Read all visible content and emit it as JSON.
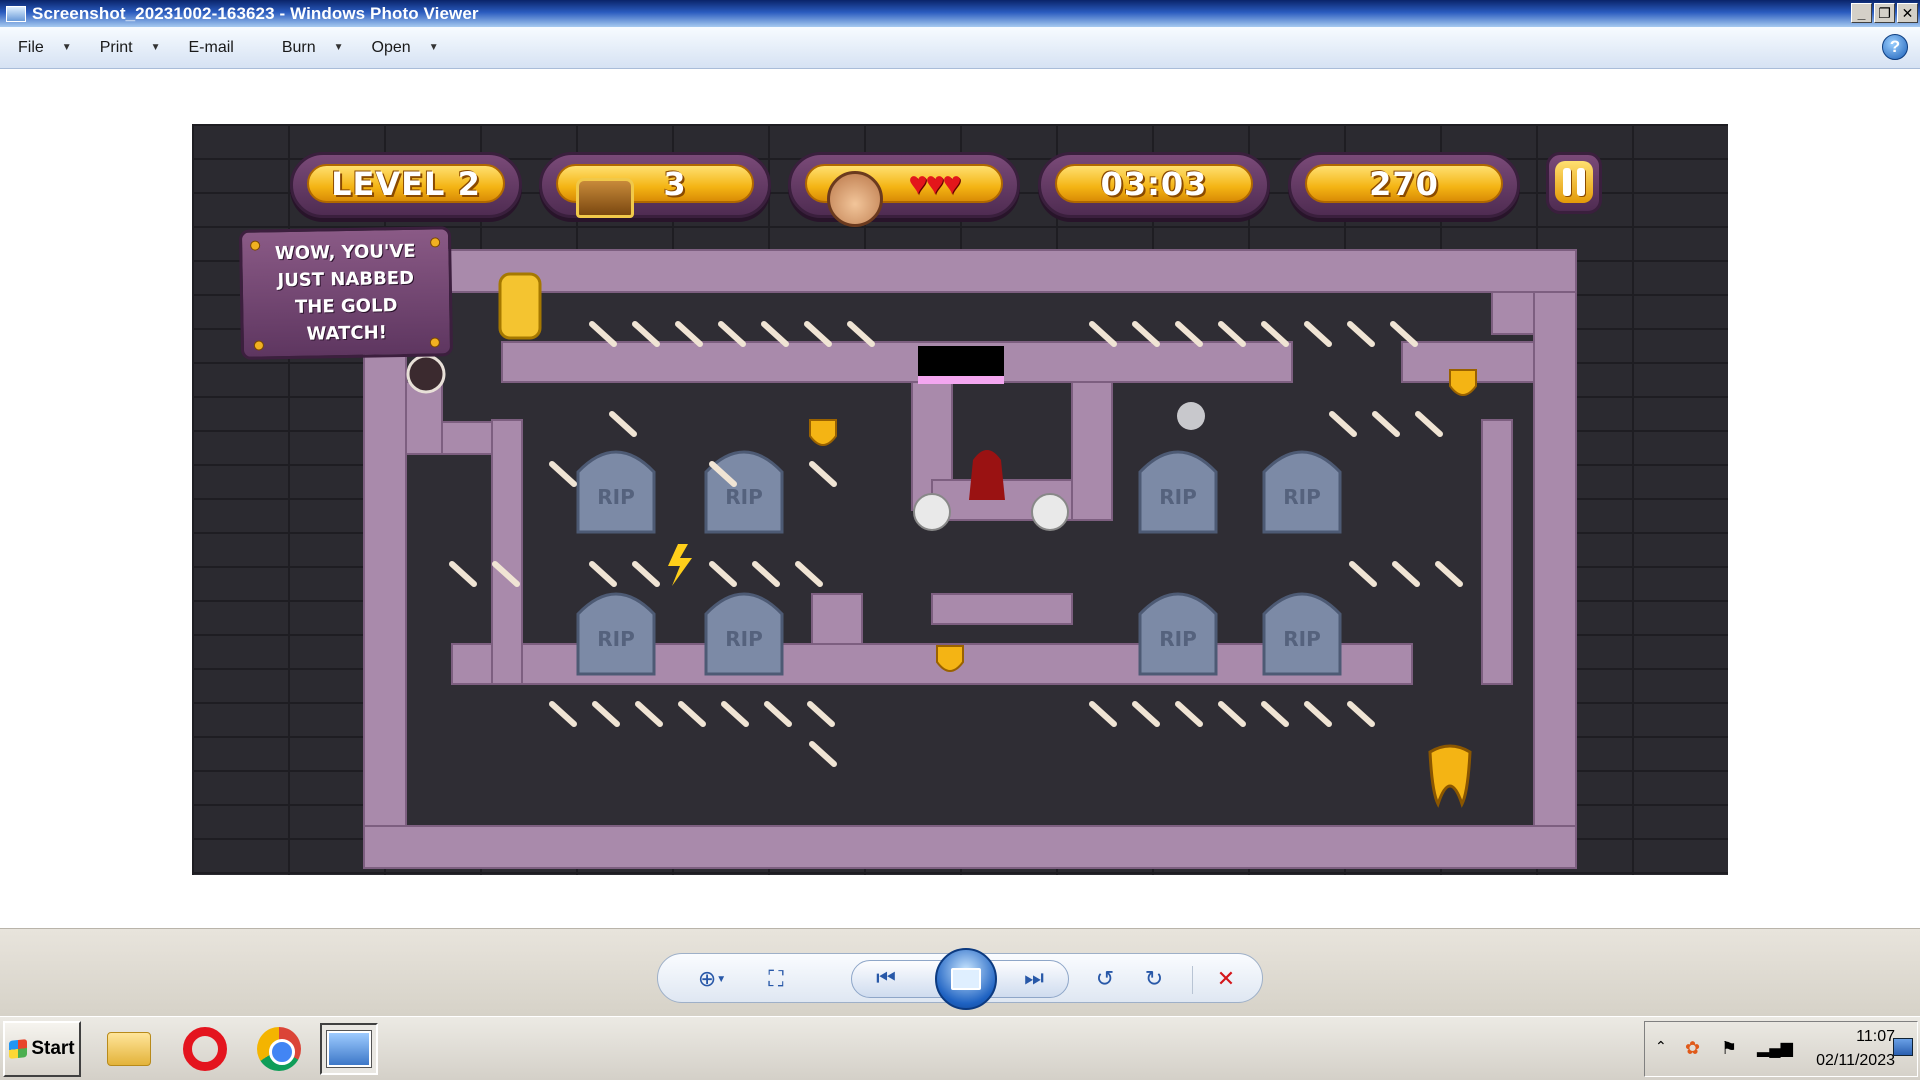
{
  "window": {
    "title": "Screenshot_20231002-163623 - Windows Photo Viewer",
    "controls": {
      "minimize": "_",
      "restore": "❐",
      "close": "✕"
    }
  },
  "menu": {
    "file": "File",
    "print": "Print",
    "email": "E-mail",
    "burn": "Burn",
    "open": "Open",
    "help": "?"
  },
  "game": {
    "level": "LEVEL 2",
    "treasure_count": "3",
    "lives": "♥♥♥",
    "lives_value": 3,
    "timer": "03:03",
    "score": "270",
    "message": "WOW, YOU'VE JUST NABBED THE GOLD WATCH!",
    "tombstone_text": "RIP",
    "small_tombstone_text": "R.I.P",
    "colors": {
      "background": "#2b2a30",
      "wall": "#a98aab",
      "floor": "#2f2d34",
      "hud_gold": "#f4b414",
      "hud_frame": "#5a3458"
    }
  },
  "viewer_toolbar": {
    "zoom": "zoom-icon",
    "actual_size": "actual-size-icon",
    "previous": "previous-icon",
    "slideshow": "slideshow-icon",
    "next": "next-icon",
    "rotate_ccw": "rotate-counterclockwise-icon",
    "rotate_cw": "rotate-clockwise-icon",
    "delete": "delete-icon"
  },
  "taskbar": {
    "start": "Start",
    "clock_time": "11:07",
    "clock_date": "02/11/2023"
  }
}
